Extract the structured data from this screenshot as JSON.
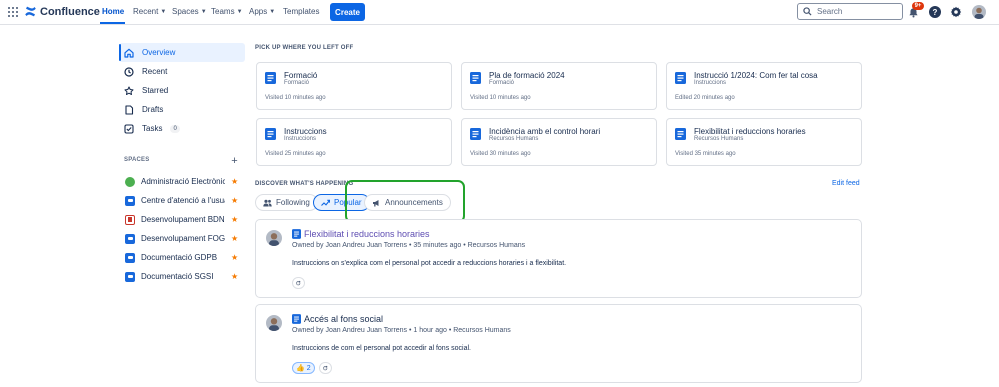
{
  "topbar": {
    "app_name": "Confluence",
    "nav": [
      {
        "label": "Home"
      },
      {
        "label": "Recent"
      },
      {
        "label": "Spaces"
      },
      {
        "label": "Teams"
      },
      {
        "label": "Apps"
      },
      {
        "label": "Templates"
      }
    ],
    "create_label": "Create",
    "search_placeholder": "Search",
    "notifications_badge": "9+",
    "help_glyph": "?"
  },
  "sidebar": {
    "items": [
      {
        "label": "Overview",
        "icon": "home-icon"
      },
      {
        "label": "Recent",
        "icon": "clock-icon"
      },
      {
        "label": "Starred",
        "icon": "star-outline-icon"
      },
      {
        "label": "Drafts",
        "icon": "draft-icon"
      },
      {
        "label": "Tasks",
        "icon": "task-icon",
        "count": "0"
      }
    ],
    "spaces_header": "SPACES",
    "spaces": [
      {
        "name": "Administració Electrònic...",
        "color": "#4caf50"
      },
      {
        "name": "Centre d'atenció a l'usuari",
        "color": "#1868db"
      },
      {
        "name": "Desenvolupament BDNS",
        "color": "#c9372c"
      },
      {
        "name": "Desenvolupament FOG...",
        "color": "#1868db"
      },
      {
        "name": "Documentació GDPB",
        "color": "#1868db"
      },
      {
        "name": "Documentació SGSI",
        "color": "#1868db"
      }
    ]
  },
  "main": {
    "pickup_header": "PICK UP WHERE YOU LEFT OFF",
    "cards": [
      {
        "title": "Formació",
        "space": "Formació",
        "visited": "Visited 10 minutes ago"
      },
      {
        "title": "Pla de formació 2024",
        "space": "Formació",
        "visited": "Visited 10 minutes ago"
      },
      {
        "title": "Instrucció 1/2024: Com fer tal cosa",
        "space": "Instruccions",
        "visited": "Edited 20 minutes ago"
      },
      {
        "title": "Instruccions",
        "space": "Instruccions",
        "visited": "Visited 25 minutes ago"
      },
      {
        "title": "Incidència amb el control horari",
        "space": "Recursos Humans",
        "visited": "Visited 30 minutes ago"
      },
      {
        "title": "Flexibilitat i reduccions horaries",
        "space": "Recursos Humans",
        "visited": "Visited 35 minutes ago"
      }
    ],
    "discover_header": "DISCOVER WHAT'S HAPPENING",
    "edit_feed": "Edit feed",
    "tabs": [
      {
        "label": "Following"
      },
      {
        "label": "Popular",
        "active": true
      },
      {
        "label": "Announcements"
      }
    ],
    "feed": [
      {
        "title": "Flexibilitat i reduccions horaries",
        "meta": "Owned by Joan Andreu Juan Torrens • 35 minutes ago • Recursos Humans",
        "excerpt": "Instruccions on s'explica com el personal pot accedir a reduccions horaries i a flexibilitat."
      },
      {
        "title": "Accés al fons social",
        "meta": "Owned by Joan Andreu Juan Torrens • 1 hour ago • Recursos Humans",
        "excerpt": "Instruccions de com el personal pot accedir al fons social.",
        "reaction_count": "2"
      }
    ]
  }
}
